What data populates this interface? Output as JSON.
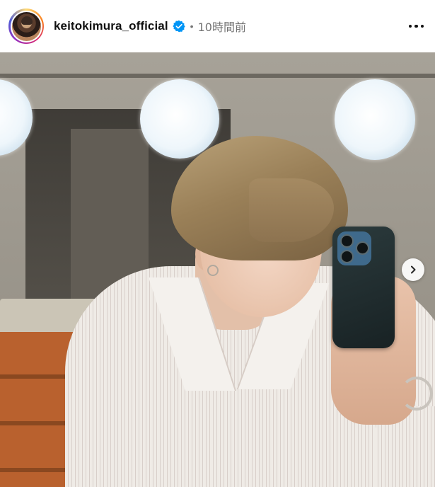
{
  "post_header": {
    "username": "keitokimura_official",
    "verified": true,
    "separator": "•",
    "timestamp": "10時間前",
    "more_icon": "more-horizontal-icon"
  },
  "post_media": {
    "type": "photo",
    "carousel_next_icon": "chevron-right-icon"
  },
  "colors": {
    "verified_blue": "#0095f6",
    "meta_gray": "#737373",
    "text_dark": "#111111"
  }
}
